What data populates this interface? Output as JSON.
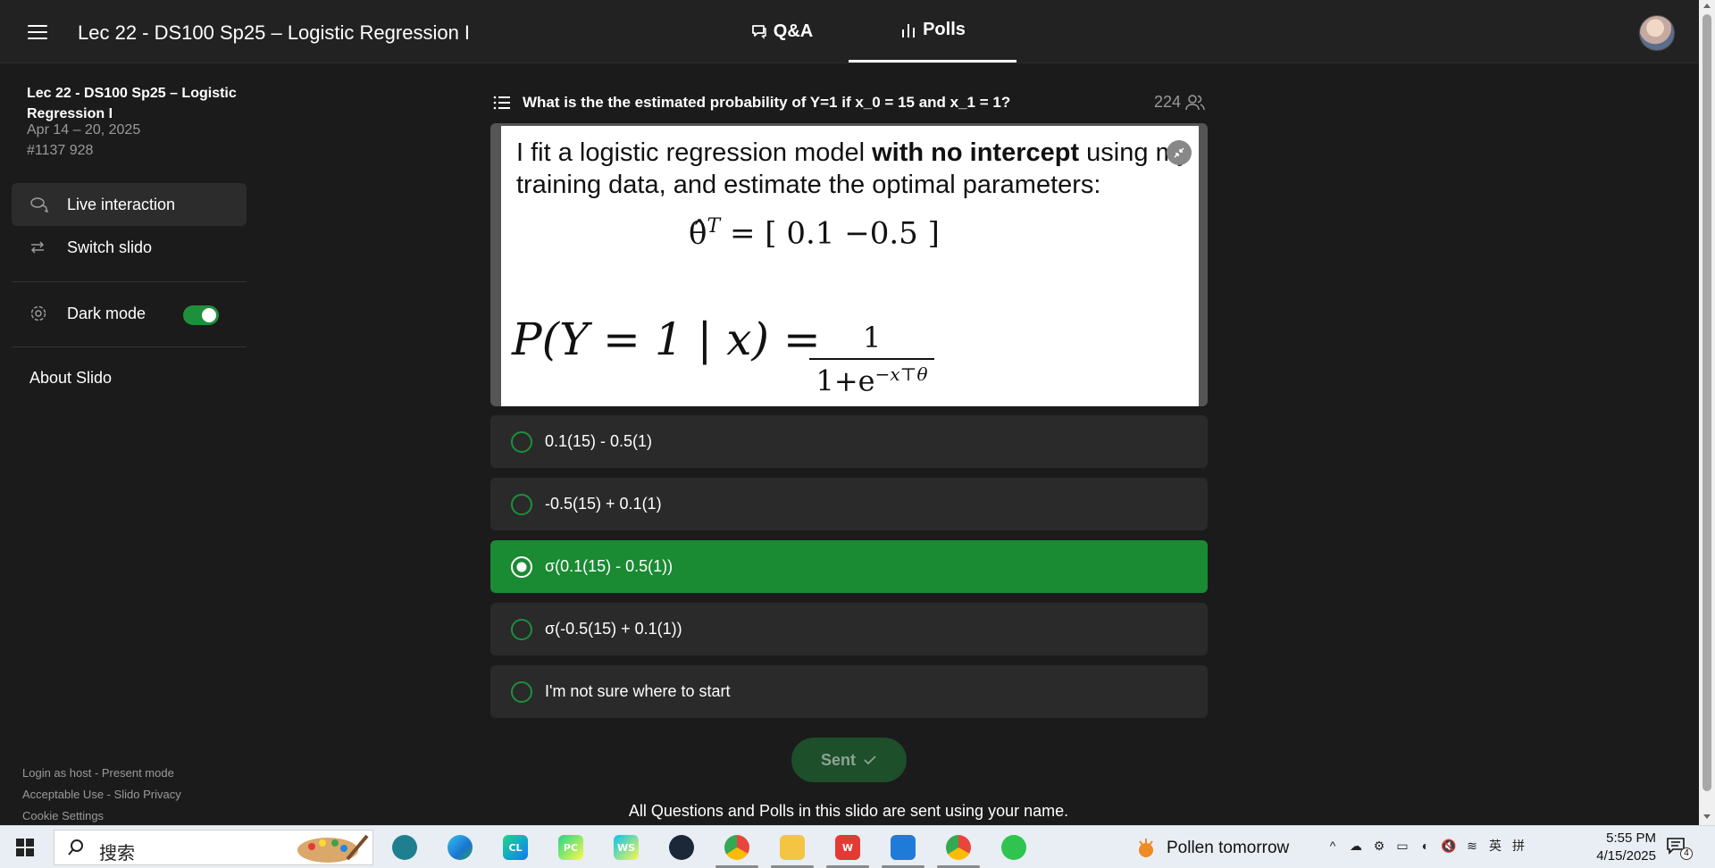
{
  "header": {
    "title": "Lec 22 - DS100 Sp25 – Logistic Regression I",
    "tabs": [
      {
        "label": "Q&A",
        "icon": "chat-bubble-icon",
        "active": false
      },
      {
        "label": "Polls",
        "icon": "bar-chart-icon",
        "active": true
      }
    ]
  },
  "sidebar": {
    "event_title": "Lec 22 - DS100 Sp25 – Logistic Regression I",
    "event_dates": "Apr 14 – 20, 2025",
    "event_code": "#1137 928",
    "items": [
      {
        "label": "Live interaction",
        "icon": "chat-icon",
        "active": true
      },
      {
        "label": "Switch slido",
        "icon": "swap-arrows-icon",
        "active": false
      }
    ],
    "dark_mode_label": "Dark mode",
    "dark_mode_on": true,
    "about_label": "About Slido",
    "footer": {
      "line1": "Login as host - Present mode",
      "line2": "Acceptable Use - Slido Privacy",
      "line3": "Cookie Settings"
    }
  },
  "poll": {
    "question": "What is the the estimated probability of Y=1 if x_0 = 15 and x_1 = 1?",
    "participant_count": "224",
    "image": {
      "text_pre": "I fit a logistic regression model ",
      "text_bold": "with no intercept",
      "text_post": " using my",
      "text_line2": "training data, and estimate the optimal parameters:",
      "eq1_lhs": "θ̂",
      "eq1_sup": "T",
      "eq1_rhs": " = [ 0.1        −0.5 ]",
      "eq2_lhs": "P(Y = 1 | x) =",
      "frac_num": "1",
      "frac_den": "1+e",
      "frac_den_sup": "−x⊤θ"
    },
    "options": [
      {
        "label": "0.1(15) - 0.5(1)",
        "selected": false
      },
      {
        "label": "-0.5(15) + 0.1(1)",
        "selected": false
      },
      {
        "label": "σ(0.1(15) - 0.5(1))",
        "selected": true
      },
      {
        "label": "σ(-0.5(15) + 0.1(1))",
        "selected": false
      },
      {
        "label": "I'm not sure where to start",
        "selected": false
      }
    ],
    "submit_label": "Sent",
    "notice": "All Questions and Polls in this slido are sent using your name."
  },
  "colors": {
    "accent_green": "#1a8a33",
    "background": "#1b1b1b",
    "option_bg": "#2a2a2a"
  },
  "taskbar": {
    "search_placeholder": "搜索",
    "apps": [
      {
        "name": "brain-app-icon",
        "color": "#1e7f8f",
        "open": false
      },
      {
        "name": "edge-browser-icon",
        "color": "#1b74d0",
        "open": false
      },
      {
        "name": "clion-icon",
        "color": "#21b87a",
        "open": false,
        "text": "CL"
      },
      {
        "name": "pycharm-icon",
        "color": "#21d789",
        "open": false,
        "text": "PC"
      },
      {
        "name": "webstorm-icon",
        "color": "#0a84ff",
        "open": false,
        "text": "WS"
      },
      {
        "name": "steam-icon",
        "color": "#1b2838",
        "open": false
      },
      {
        "name": "chrome-icon",
        "color": "#e8453c",
        "open": true
      },
      {
        "name": "file-explorer-icon",
        "color": "#f4c542",
        "open": true
      },
      {
        "name": "wps-office-icon",
        "color": "#e53935",
        "open": true
      },
      {
        "name": "vscode-icon",
        "color": "#1f7bd8",
        "open": true
      },
      {
        "name": "chrome-profile-icon",
        "color": "#e8453c",
        "open": true
      },
      {
        "name": "wechat-icon",
        "color": "#2ec44f",
        "open": false
      }
    ],
    "weather_text": "Pollen tomorrow",
    "tray": [
      "^",
      "☁",
      "⚙",
      "▭",
      "◐",
      "🔇",
      "≋"
    ],
    "ime_lang": "英",
    "ime_mode": "拼",
    "time": "5:55 PM",
    "date": "4/15/2025",
    "notification_count": "4"
  }
}
